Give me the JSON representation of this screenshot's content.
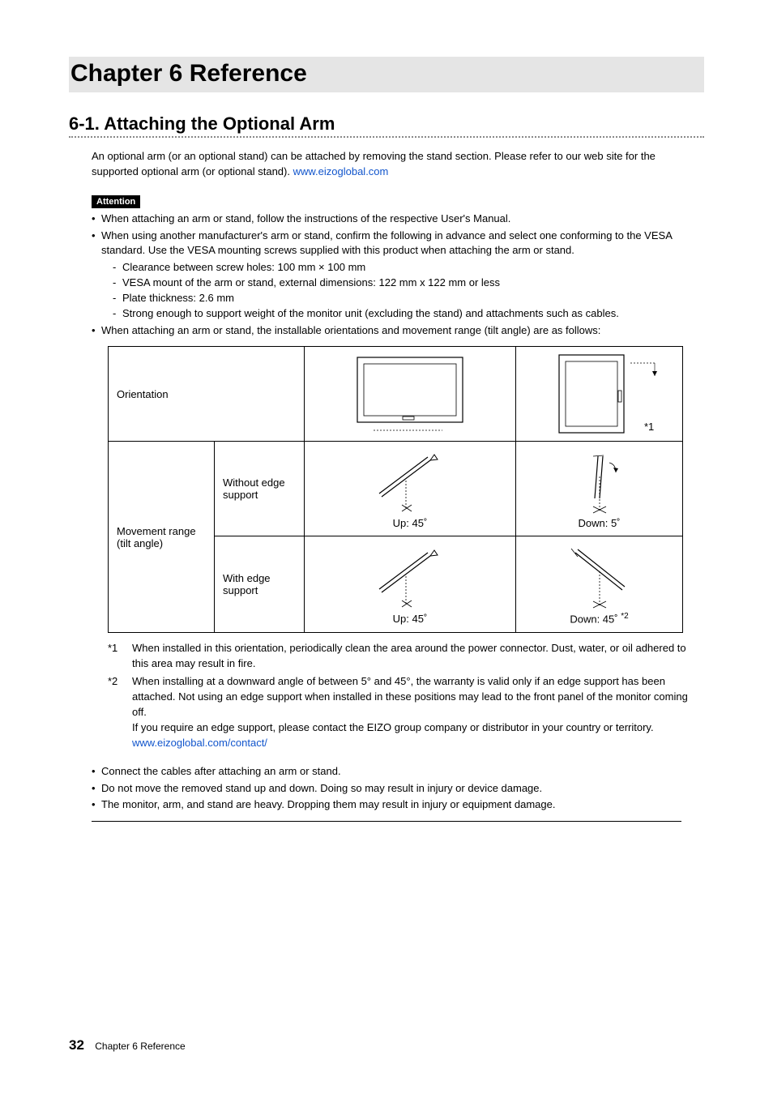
{
  "chapter_title": "Chapter 6   Reference",
  "section_title": "6-1.  Attaching the Optional Arm",
  "intro_text": "An optional arm (or an optional stand) can be attached by removing the stand section. Please refer to our web site for the supported optional arm (or optional stand). ",
  "intro_link": "www.eizoglobal.com",
  "attention_label": "Attention",
  "bullets_top": [
    "When attaching an arm or stand, follow the instructions of the respective User's Manual.",
    "When using another manufacturer's arm or stand, confirm the following in advance and select one conforming to the VESA standard. Use the VESA mounting screws supplied with this product when attaching the arm or stand."
  ],
  "dashes": [
    "Clearance between screw holes: 100 mm × 100 mm",
    "VESA mount of the arm or stand, external dimensions: 122 mm x 122 mm or less",
    "Plate thickness: 2.6 mm",
    "Strong enough to support weight of the monitor unit (excluding the stand) and attachments such as cables."
  ],
  "bullet_after_dashes": "When attaching an arm or stand, the installable orientations and movement range (tilt angle) are as follows:",
  "table": {
    "row1_label": "Orientation",
    "row1_note": "*1",
    "row2_label": "Movement range (tilt angle)",
    "row2a_sub": "Without edge support",
    "row2a_left": "Up: 45˚",
    "row2a_right": "Down: 5˚",
    "row2b_sub": "With edge support",
    "row2b_left": "Up: 45˚",
    "row2b_right_prefix": "Down: 45˚ ",
    "row2b_right_sup": "*2"
  },
  "footnotes": {
    "f1_key": "*1",
    "f1_text": "When installed in this orientation, periodically clean the area around the power connector. Dust, water, or oil adhered to this area may result in fire.",
    "f2_key": "*2",
    "f2_text1": "When installing at a downward angle of between 5° and 45°, the warranty is valid only if an edge support has been attached. Not using an edge support when installed in these positions may lead to the front panel of the monitor coming off.",
    "f2_text2": "If you require an edge support, please contact the EIZO group company or distributor in your country or territory. ",
    "f2_link": "www.eizoglobal.com/contact/"
  },
  "bullets_bottom": [
    "Connect the cables after attaching an arm or stand.",
    "Do not move the removed stand up and down. Doing so may result in injury or device damage.",
    "The monitor, arm, and stand are heavy. Dropping them may result in injury or equipment damage."
  ],
  "footer": {
    "page_number": "32",
    "footer_text": "Chapter 6 Reference"
  }
}
